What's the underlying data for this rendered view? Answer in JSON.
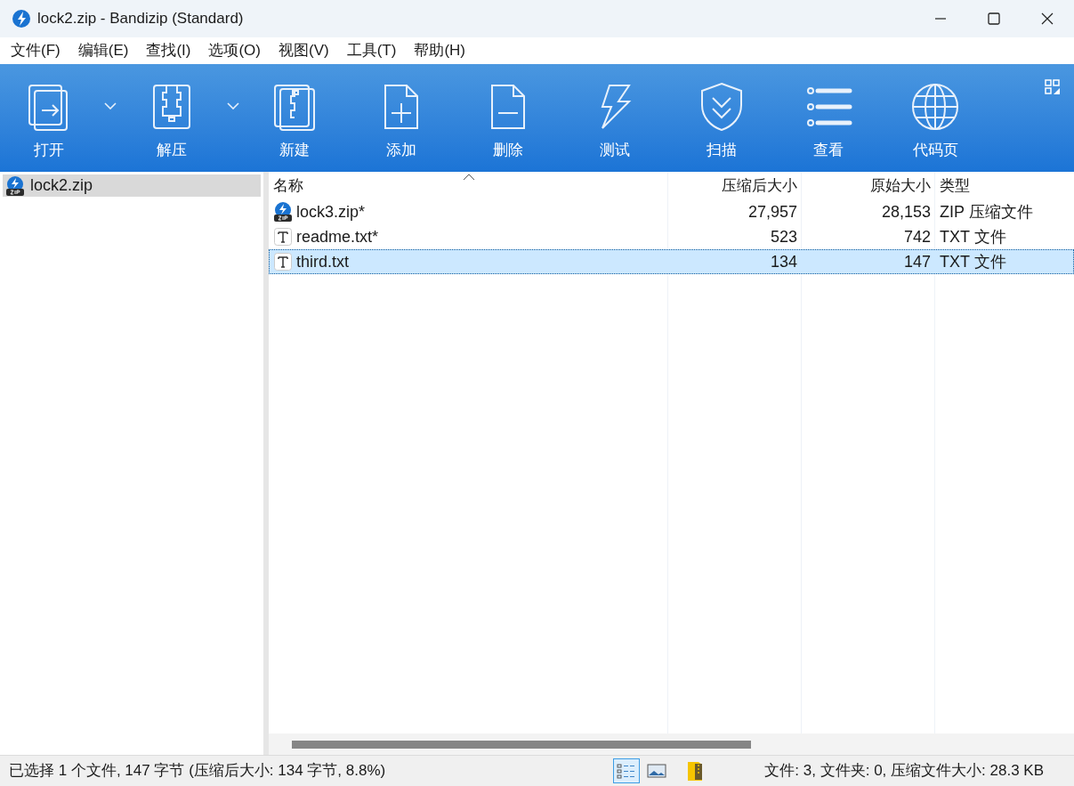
{
  "window": {
    "title": "lock2.zip - Bandizip (Standard)"
  },
  "menu": [
    "文件(F)",
    "编辑(E)",
    "查找(I)",
    "选项(O)",
    "视图(V)",
    "工具(T)",
    "帮助(H)"
  ],
  "toolbar": [
    {
      "kind": "open",
      "label": "打开",
      "dropdown": true
    },
    {
      "kind": "extract",
      "label": "解压",
      "dropdown": true
    },
    {
      "kind": "new",
      "label": "新建",
      "dropdown": false
    },
    {
      "kind": "add",
      "label": "添加",
      "dropdown": false
    },
    {
      "kind": "delete",
      "label": "删除",
      "dropdown": false
    },
    {
      "kind": "test",
      "label": "测试",
      "dropdown": false
    },
    {
      "kind": "scan",
      "label": "扫描",
      "dropdown": false
    },
    {
      "kind": "view",
      "label": "查看",
      "dropdown": false
    },
    {
      "kind": "codepage",
      "label": "代码页",
      "dropdown": false
    }
  ],
  "tree": [
    {
      "label": "lock2.zip",
      "selected": true
    }
  ],
  "table": {
    "columns": [
      {
        "label": "名称",
        "sorted": true
      },
      {
        "label": "压缩后大小",
        "sorted": false
      },
      {
        "label": "原始大小",
        "sorted": false
      },
      {
        "label": "类型",
        "sorted": false
      }
    ],
    "rows": [
      {
        "kind": "zip",
        "name": "lock3.zip*",
        "packed": "27,957",
        "size": "28,153",
        "type": "ZIP 压缩文件",
        "selected": false
      },
      {
        "kind": "txt",
        "name": "readme.txt*",
        "packed": "523",
        "size": "742",
        "type": "TXT 文件",
        "selected": false
      },
      {
        "kind": "txt",
        "name": "third.txt",
        "packed": "134",
        "size": "147",
        "type": "TXT 文件",
        "selected": true
      }
    ]
  },
  "status_bar": {
    "selection": "已选择 1 个文件, 147 字节 (压缩后大小: 134 字节, 8.8%)",
    "views": [
      {
        "kind": "details",
        "selected": true
      },
      {
        "kind": "thumbnails",
        "selected": false
      }
    ],
    "summary": "文件: 3, 文件夹: 0, 压缩文件大小: 28.3 KB"
  }
}
